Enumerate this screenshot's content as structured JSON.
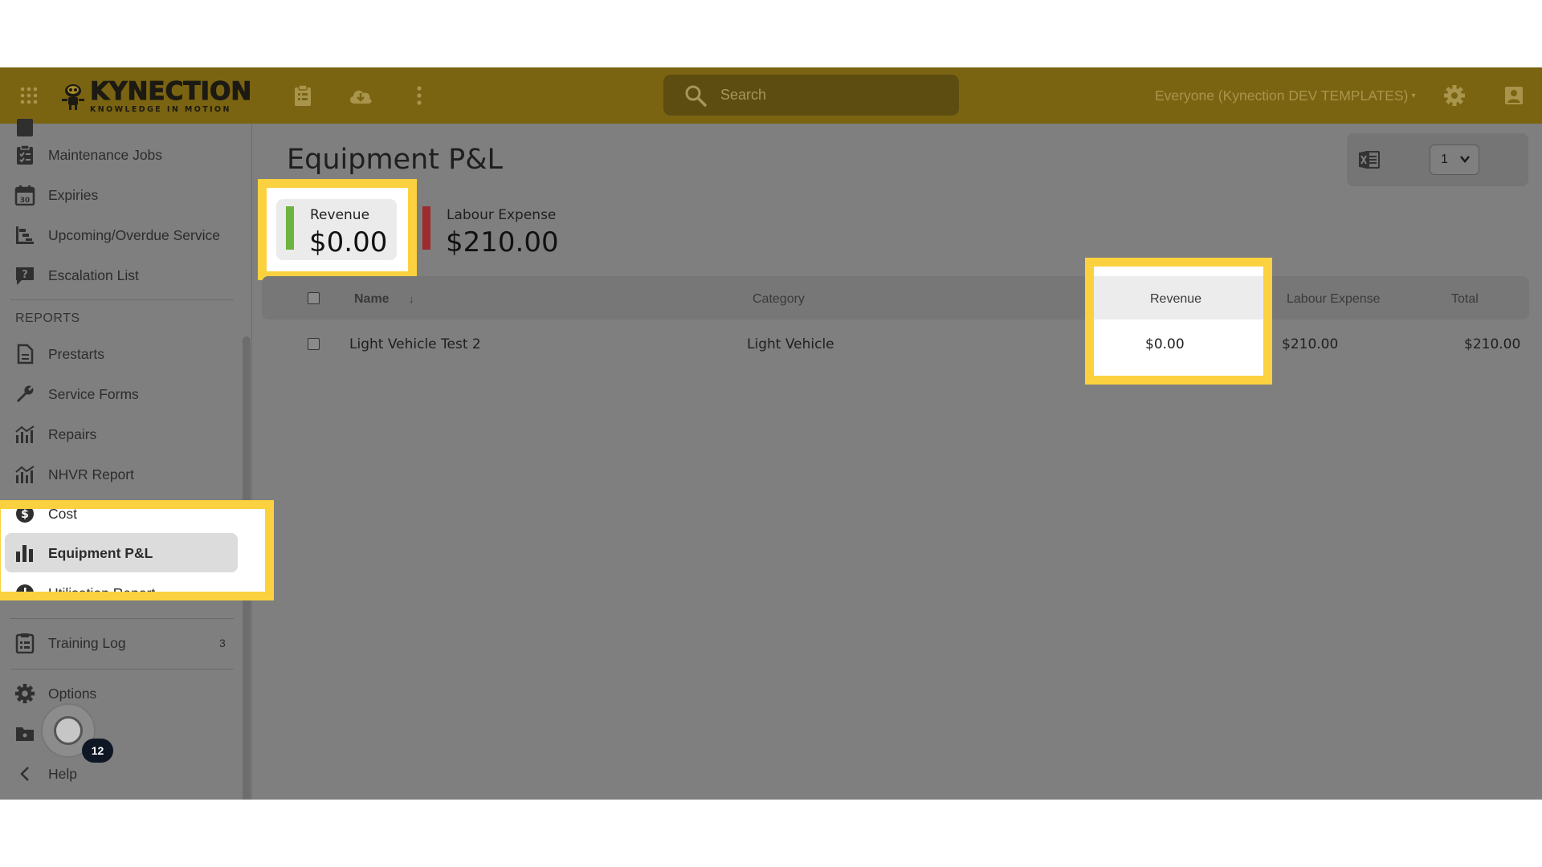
{
  "header": {
    "logo_word": "KYNECTION",
    "logo_tagline": "KNOWLEDGE IN MOTION",
    "search_placeholder": "Search",
    "scope": "Everyone (Kynection DEV TEMPLATES)",
    "scope_caret": "▾"
  },
  "sidebar": {
    "items_top": [
      {
        "label": "Maintenance Jobs",
        "icon": "clipboard-check-icon"
      },
      {
        "label": "Expiries",
        "icon": "calendar-30-icon"
      },
      {
        "label": "Upcoming/Overdue Service",
        "icon": "gantt-icon"
      },
      {
        "label": "Escalation List",
        "icon": "question-chat-icon"
      }
    ],
    "reports_heading": "REPORTS",
    "reports": [
      {
        "label": "Prestarts",
        "icon": "document-icon"
      },
      {
        "label": "Service Forms",
        "icon": "wrench-icon"
      },
      {
        "label": "Repairs",
        "icon": "chart-icon"
      },
      {
        "label": "NHVR Report",
        "icon": "chart-icon"
      },
      {
        "label": "Cost",
        "icon": "dollar-icon"
      },
      {
        "label": "Equipment P&L",
        "icon": "bar-chart-icon",
        "active": true
      },
      {
        "label": "Utilisation Report",
        "icon": "clock-icon"
      }
    ],
    "training": {
      "label": "Training Log",
      "badge": "3"
    },
    "options": {
      "label": "Options"
    },
    "help": {
      "label": "Help"
    },
    "notification_count": "12"
  },
  "main": {
    "title": "Equipment P&L",
    "page_select": "1",
    "kpis": [
      {
        "label": "Revenue",
        "value": "$0.00",
        "color": "#6cb33f"
      },
      {
        "label": "Labour Expense",
        "value": "$210.00",
        "color": "#9e2a2b"
      }
    ],
    "table": {
      "columns": [
        "Name",
        "Category",
        "Revenue",
        "Labour Expense",
        "Total"
      ],
      "sort_indicator": "↓",
      "rows": [
        {
          "name": "Light Vehicle Test 2",
          "category": "Light Vehicle",
          "revenue": "$0.00",
          "labour": "$210.00",
          "total": "$210.00"
        }
      ]
    }
  },
  "colors": {
    "highlight": "#fcd13f",
    "topbar": "#7a6412",
    "overlay": "#7f7f7f"
  }
}
